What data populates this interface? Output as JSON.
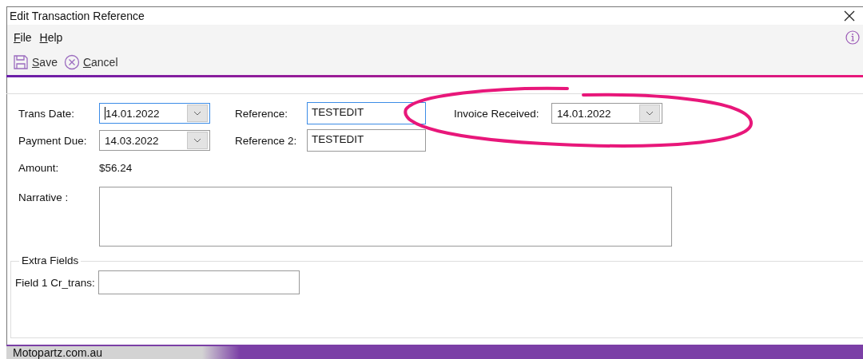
{
  "window": {
    "title": "Edit Transaction Reference"
  },
  "menu": [
    {
      "label": "File"
    },
    {
      "label": "Help"
    }
  ],
  "toolbar": [
    {
      "kind": "save",
      "label": "Save"
    },
    {
      "kind": "cancel",
      "label": "Cancel"
    }
  ],
  "form": {
    "trans_date": {
      "label": "Trans Date:",
      "value": "14.01.2022",
      "focused": true
    },
    "reference": {
      "label": "Reference:",
      "value": "TESTEDIT",
      "focused": true
    },
    "invoice_received": {
      "label": "Invoice Received:",
      "value": "14.01.2022",
      "circled": true
    },
    "payment_due": {
      "label": "Payment Due:",
      "value": "14.03.2022",
      "focused": false
    },
    "reference_2": {
      "label": "Reference 2:",
      "value": "TESTEDIT",
      "focused": false
    },
    "amount": {
      "label": "Amount:",
      "value": "$56.24"
    },
    "narrative": {
      "label": "Narrative :"
    }
  },
  "extra_fields": {
    "title": "Extra Fields",
    "fields": [
      {
        "label": "Field 1 Cr_trans:"
      }
    ]
  },
  "status_bar": {
    "text": "Motopartz.com.au"
  }
}
